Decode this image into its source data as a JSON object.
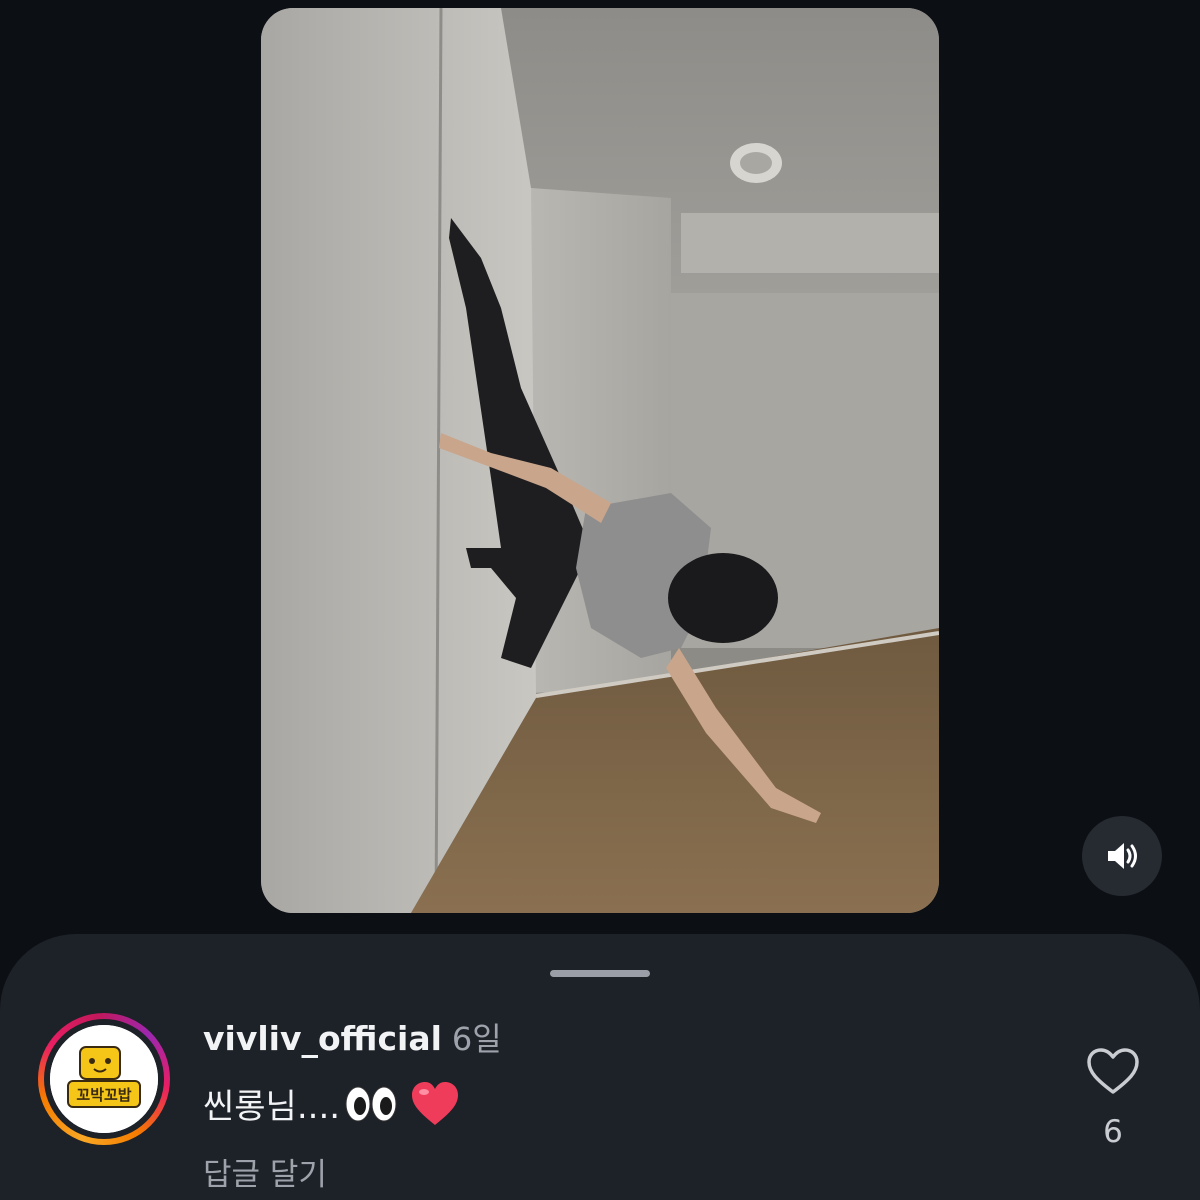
{
  "comment": {
    "username": "vivliv_official",
    "time_ago": "6일",
    "text": "씬롱님....",
    "emojis": [
      "eyes",
      "red-heart"
    ],
    "reply_label": "답글 달기",
    "like_count": "6",
    "avatar_logo_text": "꼬박꼬밥"
  },
  "icons": {
    "sound": "speaker-icon",
    "like": "heart-outline-icon"
  },
  "colors": {
    "background": "#0c0f14",
    "sheet": "#1d2128",
    "primary_text": "#f2f3f5",
    "secondary_text": "#9ea3ab",
    "avatar_badge": "#f5c518",
    "heart_emoji": "#ef3c5a"
  }
}
